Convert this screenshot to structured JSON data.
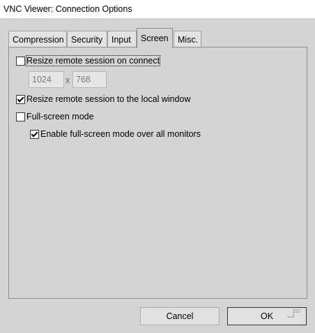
{
  "window": {
    "title": "VNC Viewer: Connection Options"
  },
  "tabs": [
    {
      "label": "Compression",
      "active": false
    },
    {
      "label": "Security",
      "active": false
    },
    {
      "label": "Input",
      "active": false
    },
    {
      "label": "Screen",
      "active": true
    },
    {
      "label": "Misc.",
      "active": false
    }
  ],
  "screen": {
    "resize_on_connect": {
      "label": "Resize remote session on connect",
      "checked": false
    },
    "width_value": "1024",
    "separator": "x",
    "height_value": "768",
    "resize_to_local": {
      "label": "Resize remote session to the local window",
      "checked": true
    },
    "full_screen": {
      "label": "Full-screen mode",
      "checked": false
    },
    "all_monitors": {
      "label": "Enable full-screen mode over all monitors",
      "checked": true
    }
  },
  "buttons": {
    "cancel": "Cancel",
    "ok": "OK"
  }
}
